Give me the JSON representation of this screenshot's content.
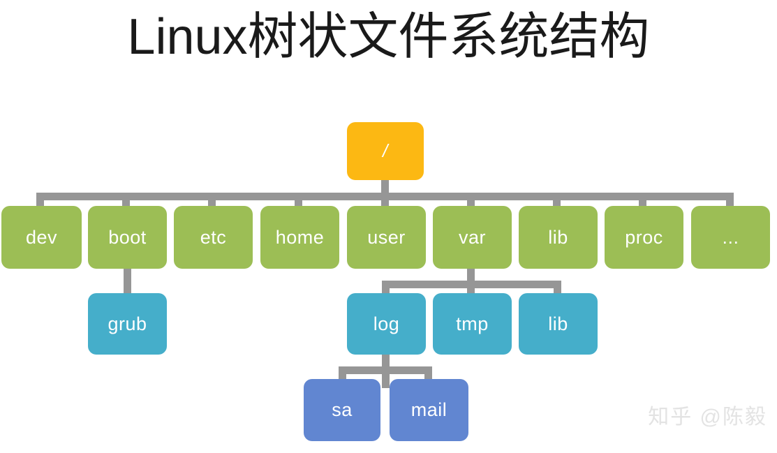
{
  "title": "Linux树状文件系统结构",
  "watermark": "知乎 @陈毅",
  "colors": {
    "background": "#ffffff",
    "title_text": "#1a1a1a",
    "connector": "#969696",
    "root_node": "#fcb813",
    "level1_node": "#9cbe55",
    "level2_node": "#45aeca",
    "level3_node": "#6186d1",
    "node_text": "#ffffff",
    "watermark_text": "#e3e3e3"
  },
  "tree": {
    "root": {
      "label": "/",
      "level": "root"
    },
    "level1": [
      {
        "label": "dev"
      },
      {
        "label": "boot"
      },
      {
        "label": "etc"
      },
      {
        "label": "home"
      },
      {
        "label": "user"
      },
      {
        "label": "var"
      },
      {
        "label": "lib"
      },
      {
        "label": "proc"
      },
      {
        "label": "..."
      }
    ],
    "level2_boot": [
      {
        "label": "grub"
      }
    ],
    "level2_var": [
      {
        "label": "log"
      },
      {
        "label": "tmp"
      },
      {
        "label": "lib"
      }
    ],
    "level3_log": [
      {
        "label": "sa"
      },
      {
        "label": "mail"
      }
    ]
  }
}
